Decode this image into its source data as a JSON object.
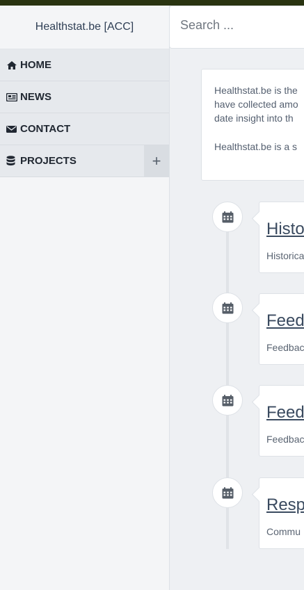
{
  "brand": {
    "title": "Healthstat.be [ACC]"
  },
  "search": {
    "placeholder": "Search ..."
  },
  "nav": {
    "home": "HOME",
    "news": "NEWS",
    "contact": "CONTACT",
    "projects": "PROJECTS",
    "projects_toggle": "+"
  },
  "intro": {
    "lines": [
      "Healthstat.be is the",
      "have collected amo",
      "date insight into th"
    ],
    "line2": "Healthstat.be is a s"
  },
  "timeline": [
    {
      "title": "Histo",
      "desc": "Historica",
      "icon": "calendar-icon"
    },
    {
      "title": "Feedb",
      "desc": "Feedbac",
      "icon": "calendar-icon"
    },
    {
      "title": "Feedb",
      "desc": "Feedbac",
      "icon": "calendar-icon"
    },
    {
      "title": "Respo",
      "desc": "Commu",
      "icon": "calendar-icon"
    }
  ],
  "colors": {
    "topbar": "#2a3411",
    "sidebar": "#f4f5f7",
    "nav_bg": "#e6e9ed",
    "page_bg": "#eef0f3"
  }
}
